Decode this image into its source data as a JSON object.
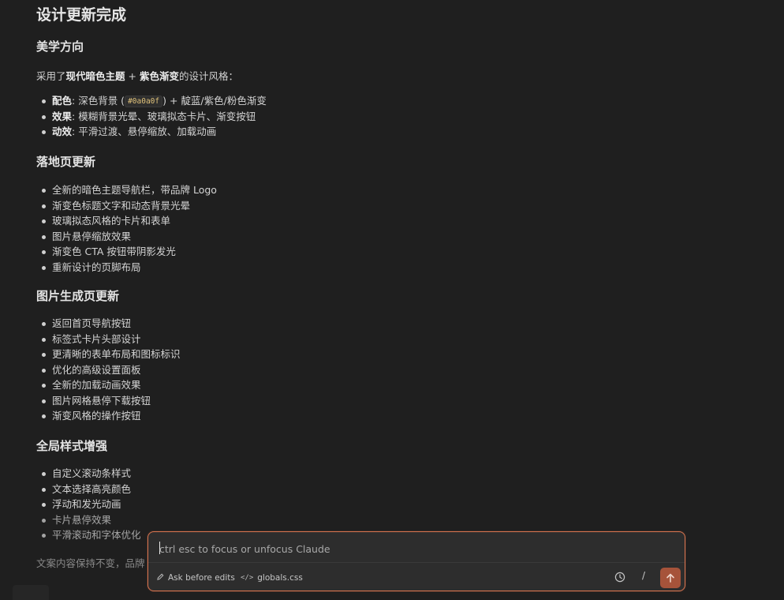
{
  "doc": {
    "title": "设计更新完成",
    "sections": {
      "aesthetic": {
        "heading": "美学方向",
        "intro_prefix": "采用了",
        "intro_bold1": "现代暗色主题",
        "intro_plus": " + ",
        "intro_bold2": "紫色渐变",
        "intro_suffix": "的设计风格：",
        "items": [
          {
            "label": "配色",
            "text_before": ": 深色背景 (",
            "code": "#0a0a0f",
            "text_after": ") + 靛蓝/紫色/粉色渐变"
          },
          {
            "label": "效果",
            "text": ": 模糊背景光晕、玻璃拟态卡片、渐变按钮"
          },
          {
            "label": "动效",
            "text": ": 平滑过渡、悬停缩放、加载动画"
          }
        ]
      },
      "landing": {
        "heading": "落地页更新",
        "items": [
          "全新的暗色主题导航栏，带品牌 Logo",
          "渐变色标题文字和动态背景光晕",
          "玻璃拟态风格的卡片和表单",
          "图片悬停缩放效果",
          "渐变色 CTA 按钮带阴影发光",
          "重新设计的页脚布局"
        ]
      },
      "generate": {
        "heading": "图片生成页更新",
        "items": [
          "返回首页导航按钮",
          "标签式卡片头部设计",
          "更清晰的表单布局和图标标识",
          "优化的高级设置面板",
          "全新的加载动画效果",
          "图片网格悬停下载按钮",
          "渐变风格的操作按钮"
        ]
      },
      "global": {
        "heading": "全局样式增强",
        "items": [
          "自定义滚动条样式",
          "文本选择高亮颜色",
          "浮动和发光动画",
          "卡片悬停效果",
          "平滑滚动和字体优化"
        ]
      }
    },
    "footer_note": "文案内容保持不变，品牌"
  },
  "prompt": {
    "placeholder": "ctrl esc to focus or unfocus Claude",
    "mode_label": "Ask before edits",
    "file_label": "globals.css",
    "slash_label": "/"
  },
  "icons": {
    "mode": "pencil-icon",
    "file": "code-icon",
    "history": "history-icon",
    "send": "arrow-up-icon"
  },
  "colors": {
    "background": "#1f1f1f",
    "panel": "#2d2d2d",
    "accent_border": "#d7744f",
    "send_button": "#a6533a"
  }
}
